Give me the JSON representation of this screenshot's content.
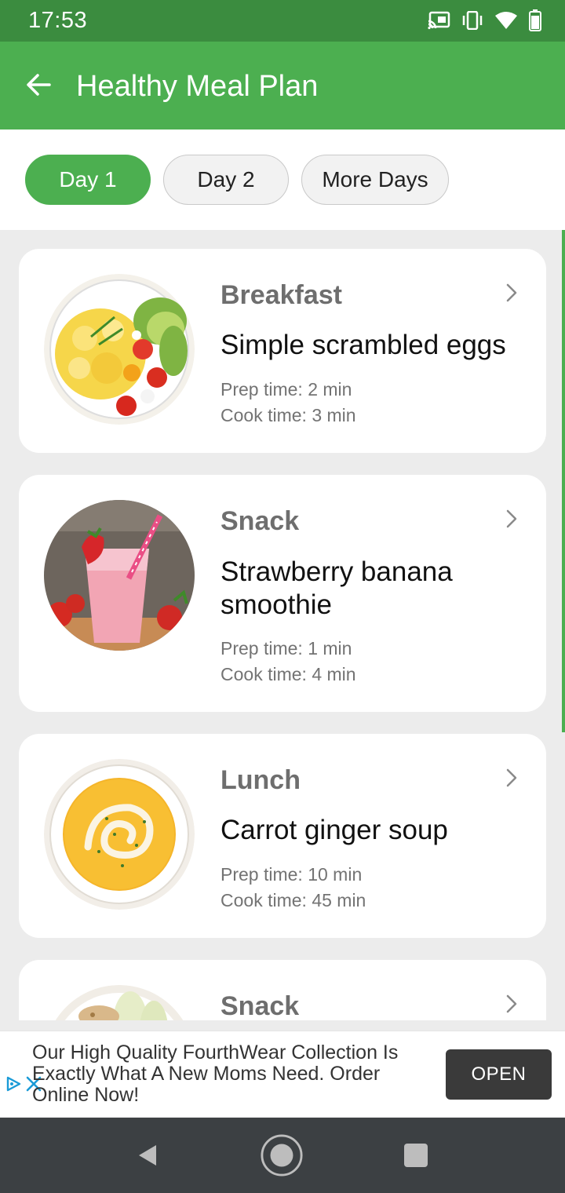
{
  "status_bar": {
    "time": "17:53",
    "icons": [
      "cast-icon",
      "vibrate-icon",
      "wifi-icon",
      "battery-icon"
    ]
  },
  "app_bar": {
    "title": "Healthy Meal Plan",
    "back_icon": "arrow-left-icon"
  },
  "tabs": [
    {
      "label": "Day 1",
      "active": true
    },
    {
      "label": "Day 2",
      "active": false
    },
    {
      "label": "More Days",
      "active": false
    }
  ],
  "meals": [
    {
      "type": "Breakfast",
      "name": "Simple scrambled eggs",
      "prep": "Prep time: 2 min",
      "cook": "Cook time: 3 min",
      "image": "scrambled-eggs-bowl"
    },
    {
      "type": "Snack",
      "name": "Strawberry banana smoothie",
      "prep": "Prep time: 1 min",
      "cook": "Cook time: 4 min",
      "image": "strawberry-smoothie"
    },
    {
      "type": "Lunch",
      "name": "Carrot ginger soup",
      "prep": "Prep time: 10 min",
      "cook": "Cook time: 45 min",
      "image": "carrot-soup"
    },
    {
      "type": "Snack",
      "image": "apple-slices-plate"
    }
  ],
  "ad": {
    "text": "Our High Quality FourthWear Collection Is Exactly What A New Moms Need. Order Online Now!",
    "open_label": "OPEN"
  },
  "nav": {
    "back": "back-icon",
    "home": "home-icon",
    "recents": "recents-icon"
  },
  "colors": {
    "status_bar": "#3b8c3f",
    "primary": "#4caf50",
    "background": "#ececec",
    "card": "#ffffff",
    "ad_button": "#3a3a3a",
    "nav_bar": "#3c4043"
  }
}
